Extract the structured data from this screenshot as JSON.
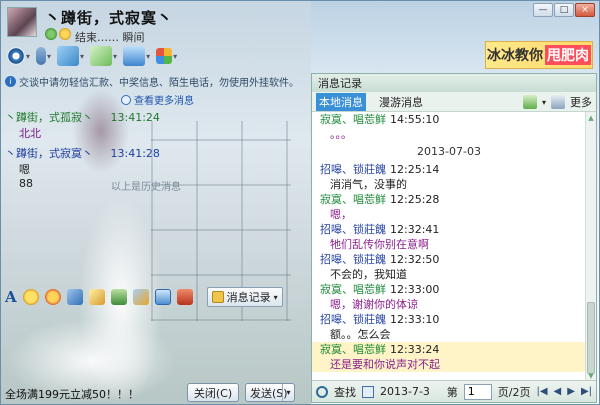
{
  "header": {
    "nickname": "丶蹲街，式寂寞丶",
    "signature": "结束…… 瞬间",
    "controls": [
      "—",
      "□",
      "×"
    ]
  },
  "ad": {
    "text": "冰冰教你",
    "highlight": "甩肥肉"
  },
  "notice": {
    "text": "交谈中请勿轻信汇款、中奖信息、陌生电话，勿使用外挂软件。"
  },
  "more_messages": "查看更多消息",
  "chat": {
    "messages": [
      {
        "name": "丶蹲街，式孤寂丶",
        "time": "13:41:24",
        "text": "北北",
        "is_me": false
      },
      {
        "name": "丶蹲街，式寂寞丶",
        "time": "13:41:28",
        "text": "嗯",
        "is_me": true
      },
      {
        "name": "",
        "time": "",
        "text": "88",
        "is_me": true
      }
    ],
    "history_separator": "以上是历史消息"
  },
  "format_bar": {
    "history_button": "消息记录"
  },
  "bottom": {
    "promo": "全场满199元立减50！！！",
    "close_label": "关闭(C)",
    "send_label": "发送(S)"
  },
  "panel": {
    "title": "消息记录",
    "tabs": [
      "本地消息",
      "漫游消息"
    ],
    "more_label": "更多",
    "log": [
      {
        "kind": "head",
        "name": "寂寞、唱莣鲜",
        "time": "14:55:10",
        "color": "green"
      },
      {
        "kind": "text",
        "text": "。。。",
        "dark": false
      },
      {
        "kind": "date",
        "text": "2013-07-03"
      },
      {
        "kind": "head",
        "name": "招嗥、锁莊餽",
        "time": "12:25:14",
        "color": "blue"
      },
      {
        "kind": "text",
        "text": "消消气，没事的",
        "dark": true
      },
      {
        "kind": "head",
        "name": "寂寞、唱莣鲜",
        "time": "12:25:28",
        "color": "green"
      },
      {
        "kind": "text",
        "text": "嗯，",
        "dark": false
      },
      {
        "kind": "head",
        "name": "招嗥、锁莊餽",
        "time": "12:32:41",
        "color": "blue"
      },
      {
        "kind": "text",
        "text": "牠们乱传你别在意啊",
        "dark": false
      },
      {
        "kind": "head",
        "name": "招嗥、锁莊餽",
        "time": "12:32:50",
        "color": "blue"
      },
      {
        "kind": "text",
        "text": "不会的，我知道",
        "dark": true
      },
      {
        "kind": "head",
        "name": "寂寞、唱莣鲜",
        "time": "12:33:00",
        "color": "green"
      },
      {
        "kind": "text",
        "text": "嗯，谢谢你的体谅",
        "dark": false
      },
      {
        "kind": "head",
        "name": "招嗥、锁莊餽",
        "time": "12:33:10",
        "color": "blue"
      },
      {
        "kind": "text",
        "text": "额。。怎么会",
        "dark": true
      },
      {
        "kind": "head",
        "name": "寂寞、唱莣鲜",
        "time": "12:33:24",
        "color": "green",
        "selected": true
      },
      {
        "kind": "text",
        "text": "还是要和你说声对不起",
        "dark": false,
        "selected": true
      }
    ],
    "footer": {
      "search_label": "查找",
      "date": "2013-7-3",
      "page_label": "第",
      "page_value": "1",
      "page_total": "页/2页"
    }
  },
  "colors": {
    "green_name": "#1e8b3a",
    "blue_name": "#2947a6",
    "purple_text": "#8a1f8e",
    "tab_active": "#3a8fd9",
    "ad_highlight": "#ff4e5b"
  }
}
